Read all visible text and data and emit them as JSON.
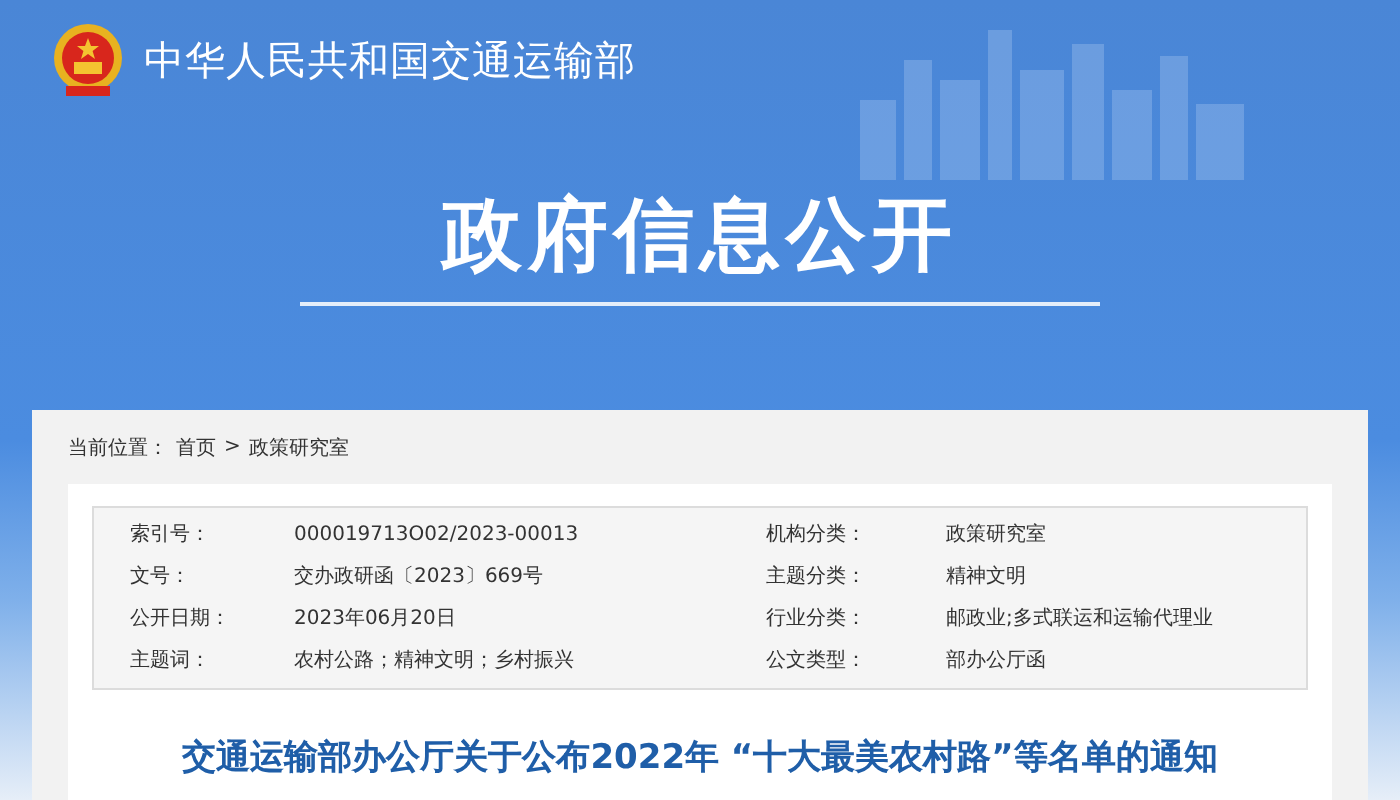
{
  "header": {
    "site_name": "中华人民共和国交通运输部",
    "section_title": "政府信息公开"
  },
  "breadcrumb": {
    "label": "当前位置：",
    "items": [
      "首页",
      ">",
      "政策研究室"
    ]
  },
  "info_table": {
    "rows": [
      {
        "label_1": "索引号：",
        "value_1": "000019713O02/2023-00013",
        "label_2": "机构分类：",
        "value_2": "政策研究室"
      },
      {
        "label_1": "文号：",
        "value_1": "交办政研函〔2023〕669号",
        "label_2": "主题分类：",
        "value_2": "精神文明"
      },
      {
        "label_1": "公开日期：",
        "value_1": "2023年06月20日",
        "label_2": "行业分类：",
        "value_2": "邮政业;多式联运和运输代理业"
      },
      {
        "label_1": "主题词：",
        "value_1": "农村公路；精神文明；乡村振兴",
        "label_2": "公文类型：",
        "value_2": "部办公厅函"
      }
    ]
  },
  "article": {
    "title": "交通运输部办公厅关于公布2022年 “十大最美农村路”等名单的通知"
  }
}
